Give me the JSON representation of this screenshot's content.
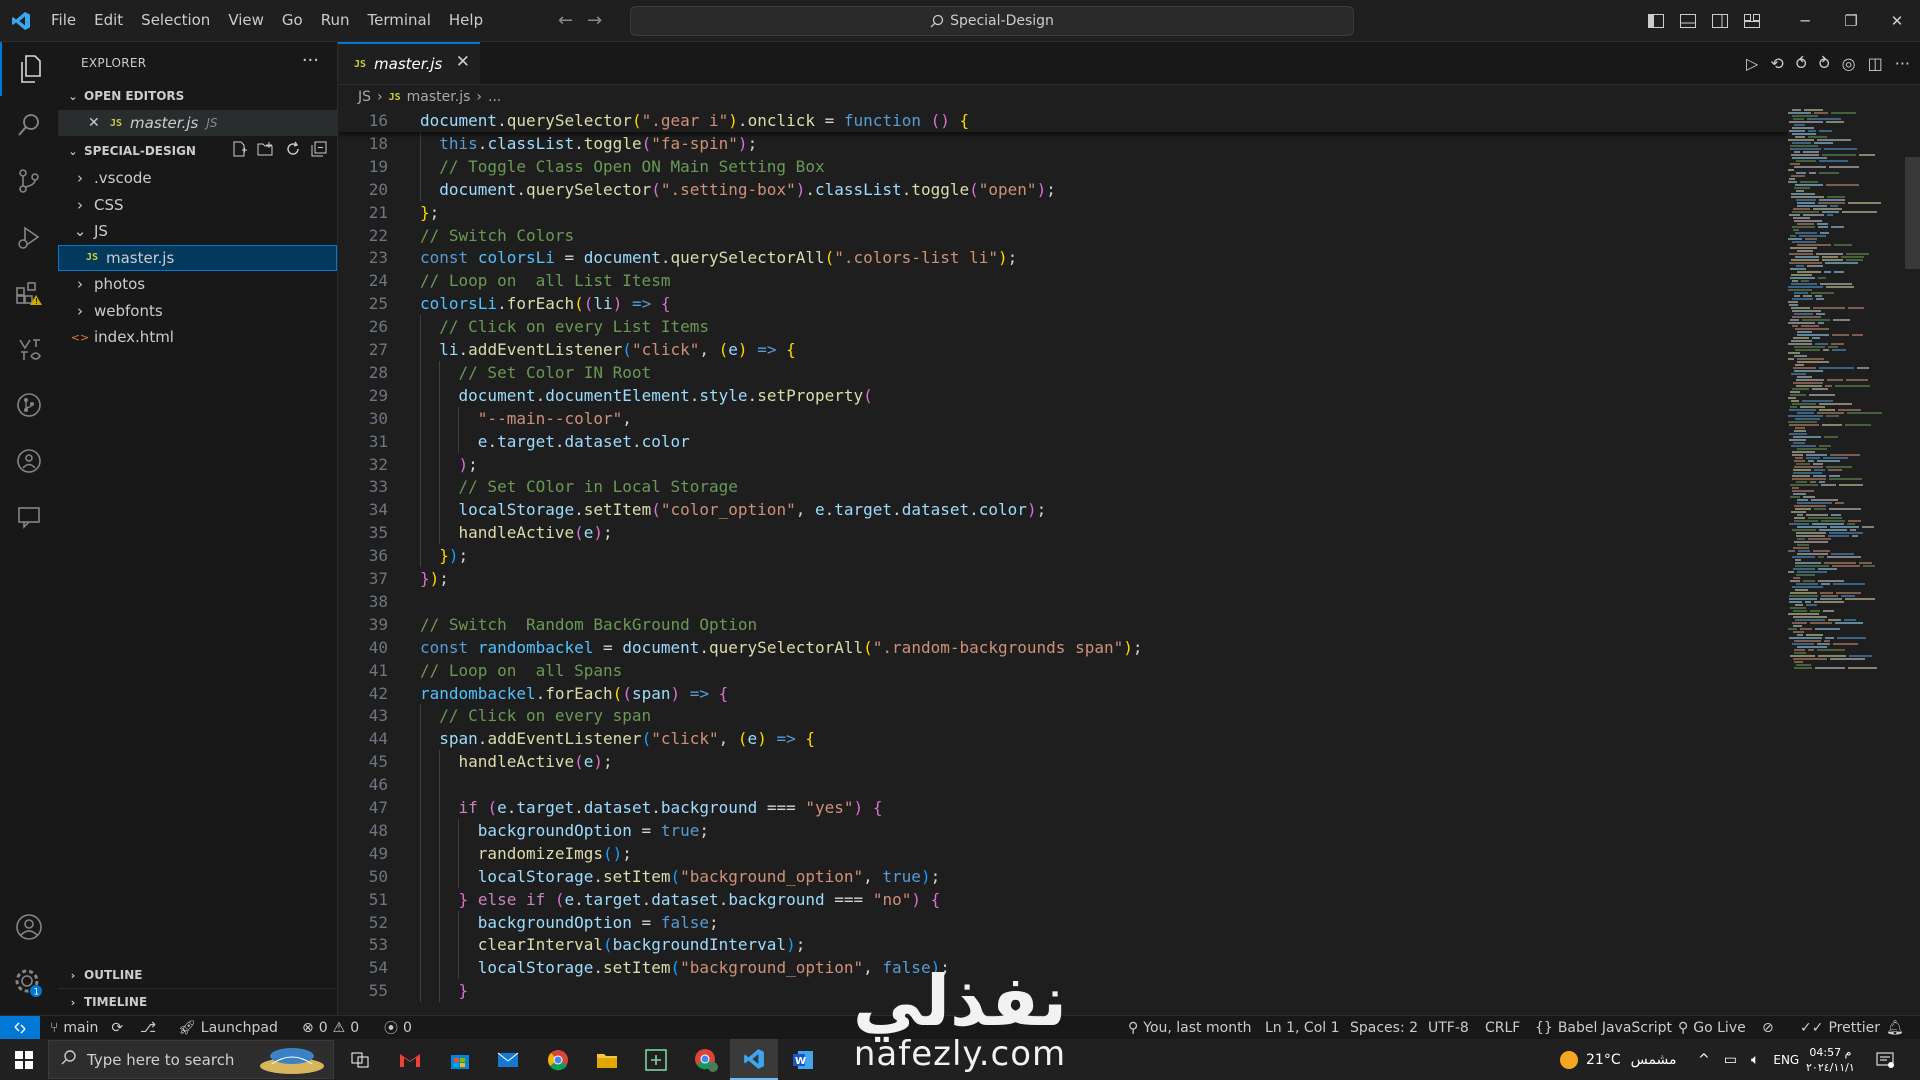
{
  "menu": [
    "File",
    "Edit",
    "Selection",
    "View",
    "Go",
    "Run",
    "Terminal",
    "Help"
  ],
  "search": {
    "label": "Special-Design"
  },
  "explorer": {
    "title": "EXPLORER",
    "open_editors_label": "OPEN EDITORS",
    "open_editor": {
      "name": "master.js",
      "suffix": "JS"
    },
    "project_label": "SPECIAL-DESIGN",
    "tree": [
      {
        "label": ".vscode",
        "type": "folder"
      },
      {
        "label": "CSS",
        "type": "folder"
      },
      {
        "label": "JS",
        "type": "folder-open"
      },
      {
        "label": "master.js",
        "type": "js-file"
      },
      {
        "label": "photos",
        "type": "folder"
      },
      {
        "label": "webfonts",
        "type": "folder"
      },
      {
        "label": "index.html",
        "type": "html-file"
      }
    ],
    "outline_label": "OUTLINE",
    "timeline_label": "TIMELINE"
  },
  "tab": {
    "label": "master.js",
    "badge": "JS"
  },
  "breadcrumb": {
    "folder": "JS",
    "file": "master.js",
    "more": "..."
  },
  "code": {
    "lines": [
      {
        "n": "16",
        "html": "<span class='var'>document</span>.<span class='fn'>querySelector</span><span class='pr'>(</span><span class='str'>\".gear i\"</span><span class='pr'>)</span>.<span class='fn'>onclick</span> = <span class='kw'>function</span> <span class='pb'>()</span> <span class='pr'>{</span>",
        "sticky": true
      },
      {
        "n": "18",
        "html": "  <span class='kw'>this</span>.<span class='var'>classList</span>.<span class='fn'>toggle</span><span class='pb'>(</span><span class='str'>\"fa-spin\"</span><span class='pb'>)</span>;",
        "g": [
          1
        ]
      },
      {
        "n": "19",
        "html": "  <span class='cm'>// Toggle Class Open ON Main Setting Box</span>",
        "g": [
          1
        ]
      },
      {
        "n": "20",
        "html": "  <span class='var'>document</span>.<span class='fn'>querySelector</span><span class='pb'>(</span><span class='str'>\".setting-box\"</span><span class='pb'>)</span>.<span class='var'>classList</span>.<span class='fn'>toggle</span><span class='pb'>(</span><span class='str'>\"open\"</span><span class='pb'>)</span>;",
        "g": [
          1
        ]
      },
      {
        "n": "21",
        "html": "<span class='pr'>}</span>;"
      },
      {
        "n": "22",
        "html": "<span class='cm'>// Switch Colors</span>"
      },
      {
        "n": "23",
        "html": "<span class='kw'>const</span> <span class='cl'>colorsLi</span> = <span class='var'>document</span>.<span class='fn'>querySelectorAll</span><span class='pr'>(</span><span class='str'>\".colors-list li\"</span><span class='pr'>)</span>;"
      },
      {
        "n": "24",
        "html": "<span class='cm'>// Loop on  all List Itesm</span>"
      },
      {
        "n": "25",
        "html": "<span class='cl'>colorsLi</span>.<span class='fn'>forEach</span><span class='pr'>(</span><span class='pb'>(</span><span class='var'>li</span><span class='pb'>)</span> <span class='kw'>=&gt;</span> <span class='pb'>{</span>"
      },
      {
        "n": "26",
        "html": "  <span class='cm'>// Click on every List Items</span>",
        "g": [
          1
        ]
      },
      {
        "n": "27",
        "html": "  <span class='var'>li</span>.<span class='fn'>addEventListener</span><span class='pc'>(</span><span class='str'>\"click\"</span>, <span class='pr'>(</span><span class='var'>e</span><span class='pr'>)</span> <span class='kw'>=&gt;</span> <span class='pr'>{</span>",
        "g": [
          1
        ]
      },
      {
        "n": "28",
        "html": "    <span class='cm'>// Set Color IN Root</span>",
        "g": [
          1,
          2
        ]
      },
      {
        "n": "29",
        "html": "    <span class='var'>document</span>.<span class='var'>documentElement</span>.<span class='var'>style</span>.<span class='fn'>setProperty</span><span class='pb'>(</span>",
        "g": [
          1,
          2
        ]
      },
      {
        "n": "30",
        "html": "      <span class='str'>\"--main--color\"</span>,",
        "g": [
          1,
          2,
          3
        ]
      },
      {
        "n": "31",
        "html": "      <span class='var'>e</span>.<span class='var'>target</span>.<span class='var'>dataset</span>.<span class='var'>color</span>",
        "g": [
          1,
          2,
          3
        ]
      },
      {
        "n": "32",
        "html": "    <span class='pb'>)</span>;",
        "g": [
          1,
          2
        ]
      },
      {
        "n": "33",
        "html": "    <span class='cm'>// Set COlor in Local Storage</span>",
        "g": [
          1,
          2
        ]
      },
      {
        "n": "34",
        "html": "    <span class='var'>localStorage</span>.<span class='fn'>setItem</span><span class='pb'>(</span><span class='str'>\"color_option\"</span>, <span class='var'>e</span>.<span class='var'>target</span>.<span class='var'>dataset</span>.<span class='var'>color</span><span class='pb'>)</span>;",
        "g": [
          1,
          2
        ]
      },
      {
        "n": "35",
        "html": "    <span class='fn'>handleActive</span><span class='pb'>(</span><span class='var'>e</span><span class='pb'>)</span>;",
        "g": [
          1,
          2
        ]
      },
      {
        "n": "36",
        "html": "  <span class='pr'>}</span><span class='pc'>)</span>;",
        "g": [
          1
        ]
      },
      {
        "n": "37",
        "html": "<span class='pb'>}</span><span class='pr'>)</span>;"
      },
      {
        "n": "38",
        "html": ""
      },
      {
        "n": "39",
        "html": "<span class='cm'>// Switch  Random BackGround Option</span>"
      },
      {
        "n": "40",
        "html": "<span class='kw'>const</span> <span class='cl'>randombackel</span> = <span class='var'>document</span>.<span class='fn'>querySelectorAll</span><span class='pr'>(</span><span class='str'>\".random-backgrounds span\"</span><span class='pr'>)</span>;"
      },
      {
        "n": "41",
        "html": "<span class='cm'>// Loop on  all Spans</span>"
      },
      {
        "n": "42",
        "html": "<span class='cl'>randombackel</span>.<span class='fn'>forEach</span><span class='pr'>(</span><span class='pb'>(</span><span class='var'>span</span><span class='pb'>)</span> <span class='kw'>=&gt;</span> <span class='pb'>{</span>"
      },
      {
        "n": "43",
        "html": "  <span class='cm'>// Click on every span</span>",
        "g": [
          1
        ]
      },
      {
        "n": "44",
        "html": "  <span class='var'>span</span>.<span class='fn'>addEventListener</span><span class='pc'>(</span><span class='str'>\"click\"</span>, <span class='pr'>(</span><span class='var'>e</span><span class='pr'>)</span> <span class='kw'>=&gt;</span> <span class='pr'>{</span>",
        "g": [
          1
        ]
      },
      {
        "n": "45",
        "html": "    <span class='fn'>handleActive</span><span class='pb'>(</span><span class='var'>e</span><span class='pb'>)</span>;",
        "g": [
          1,
          2
        ]
      },
      {
        "n": "46",
        "html": "",
        "g": [
          1,
          2
        ]
      },
      {
        "n": "47",
        "html": "    <span class='kw2'>if</span> <span class='pb'>(</span><span class='var'>e</span>.<span class='var'>target</span>.<span class='var'>dataset</span>.<span class='var'>background</span> === <span class='str'>\"yes\"</span><span class='pb'>)</span> <span class='pb'>{</span>",
        "g": [
          1,
          2
        ]
      },
      {
        "n": "48",
        "html": "      <span class='var'>backgroundOption</span> = <span class='kw'>true</span>;",
        "g": [
          1,
          2,
          3
        ]
      },
      {
        "n": "49",
        "html": "      <span class='fn'>randomizeImgs</span><span class='pc'>()</span>;",
        "g": [
          1,
          2,
          3
        ]
      },
      {
        "n": "50",
        "html": "      <span class='var'>localStorage</span>.<span class='fn'>setItem</span><span class='pc'>(</span><span class='str'>\"background_option\"</span>, <span class='kw'>true</span><span class='pc'>)</span>;",
        "g": [
          1,
          2,
          3
        ]
      },
      {
        "n": "51",
        "html": "    <span class='pb'>}</span> <span class='kw2'>else if</span> <span class='pb'>(</span><span class='var'>e</span>.<span class='var'>target</span>.<span class='var'>dataset</span>.<span class='var'>background</span> === <span class='str'>\"no\"</span><span class='pb'>)</span> <span class='pb'>{</span>",
        "g": [
          1,
          2
        ]
      },
      {
        "n": "52",
        "html": "      <span class='var'>backgroundOption</span> = <span class='kw'>false</span>;",
        "g": [
          1,
          2,
          3
        ]
      },
      {
        "n": "53",
        "html": "      <span class='fn'>clearInterval</span><span class='pc'>(</span><span class='var'>backgroundInterval</span><span class='pc'>)</span>;",
        "g": [
          1,
          2,
          3
        ]
      },
      {
        "n": "54",
        "html": "      <span class='var'>localStorage</span>.<span class='fn'>setItem</span><span class='pc'>(</span><span class='str'>\"background_option\"</span>, <span class='kw'>false</span><span class='pc'>)</span>;",
        "g": [
          1,
          2,
          3
        ]
      },
      {
        "n": "55",
        "html": "    <span class='pb'>}</span>",
        "g": [
          1,
          2
        ]
      }
    ]
  },
  "status": {
    "branch": "main",
    "launchpad": "Launchpad",
    "errors": "0",
    "warnings": "0",
    "ports": "0",
    "blame": "You, last month",
    "position": "Ln 1, Col 1",
    "spaces": "Spaces: 2",
    "encoding": "UTF-8",
    "eol": "CRLF",
    "language": "Babel JavaScript",
    "golive": "Go Live",
    "prettier": "Prettier"
  },
  "taskbar": {
    "search_placeholder": "Type here to search",
    "weather": "21°C",
    "weather_desc": "مشمس",
    "lang": "ENG",
    "time": "04:57 م",
    "date": "٢٠٢٤/١١/١"
  },
  "watermark": {
    "arabic": "نفذلي",
    "latin": "nafezly.com"
  },
  "colors": {
    "accent": "#0078d4",
    "bg": "#1e1e1e",
    "sidebar": "#181818"
  }
}
